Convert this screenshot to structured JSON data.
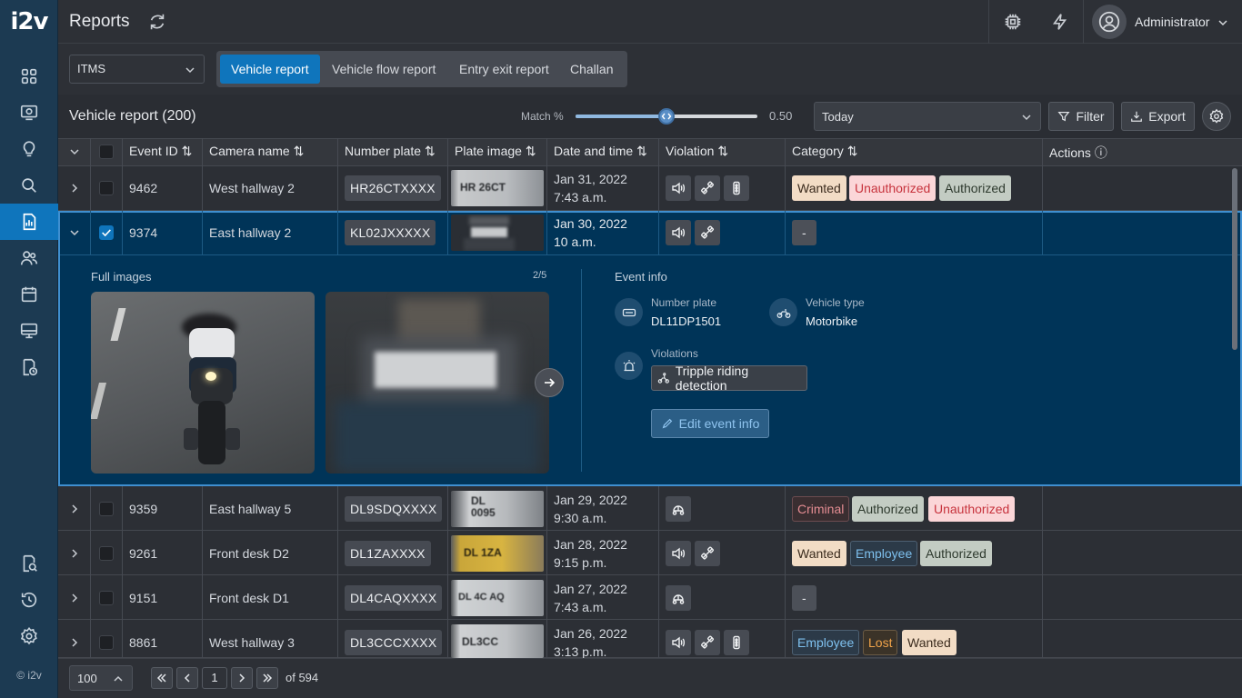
{
  "app": {
    "logo": "i2v",
    "copyright": "© i2v"
  },
  "header": {
    "title": "Reports",
    "user": "Administrator"
  },
  "toolbar": {
    "select": "ITMS",
    "tabs": [
      {
        "label": "Vehicle report",
        "active": true
      },
      {
        "label": "Vehicle flow report"
      },
      {
        "label": "Entry exit report"
      },
      {
        "label": "Challan"
      }
    ]
  },
  "subbar": {
    "title": "Vehicle report (200)",
    "match_label": "Match %",
    "match_value": "0.50",
    "match_fraction": 0.5,
    "date_select": "Today",
    "filter_label": "Filter",
    "export_label": "Export"
  },
  "table": {
    "columns": [
      "Event ID",
      "Camera name",
      "Number plate",
      "Plate image",
      "Date and time",
      "Violation",
      "Category",
      "Actions"
    ],
    "rows": [
      {
        "id": "9462",
        "camera": "West hallway 2",
        "plate": "HR26CTXXXX",
        "plate_img": "HR 26CT",
        "date": "Jan 31, 2022",
        "time": "7:43 a.m.",
        "violations": [
          "horn-icon",
          "seatbelt-icon",
          "signal-icon"
        ],
        "tags": [
          {
            "label": "Wanted",
            "type": "wanted"
          },
          {
            "label": "Unauthorized",
            "type": "unauth"
          },
          {
            "label": "Authorized",
            "type": "auth"
          }
        ]
      },
      {
        "id": "9374",
        "camera": "East hallway 2",
        "plate": "KL02JXXXXX",
        "plate_img": "",
        "date": "Jan 30, 2022",
        "time": "10 a.m.",
        "violations": [
          "horn-icon",
          "seatbelt-icon"
        ],
        "tags": [
          {
            "label": "-",
            "type": "dash"
          }
        ]
      },
      {
        "id": "9359",
        "camera": "East hallway 5",
        "plate": "DL9SDQXXXX",
        "plate_img": "DL 0095",
        "date": "Jan 29, 2022",
        "time": "9:30 a.m.",
        "violations": [
          "helmet-icon"
        ],
        "tags": [
          {
            "label": "Criminal",
            "type": "criminal"
          },
          {
            "label": "Authorized",
            "type": "auth"
          },
          {
            "label": "Unauthorized",
            "type": "unauth"
          }
        ]
      },
      {
        "id": "9261",
        "camera": "Front desk D2",
        "plate": "DL1ZAXXXX",
        "plate_img": "DL 1ZA",
        "date": "Jan 28, 2022",
        "time": "9:15 p.m.",
        "violations": [
          "horn-icon",
          "seatbelt-icon"
        ],
        "tags": [
          {
            "label": "Wanted",
            "type": "wanted"
          },
          {
            "label": "Employee",
            "type": "employee"
          },
          {
            "label": "Authorized",
            "type": "auth"
          }
        ]
      },
      {
        "id": "9151",
        "camera": "Front desk D1",
        "plate": "DL4CAQXXXX",
        "plate_img": "DL 4C AQ",
        "date": "Jan 27, 2022",
        "time": "7:43 a.m.",
        "violations": [
          "helmet-icon"
        ],
        "tags": [
          {
            "label": "-",
            "type": "dash"
          }
        ]
      },
      {
        "id": "8861",
        "camera": "West hallway 3",
        "plate": "DL3CCCXXXX",
        "plate_img": "DL3CC",
        "date": "Jan 26, 2022",
        "time": "3:13 p.m.",
        "violations": [
          "horn-icon",
          "seatbelt-icon",
          "signal-icon"
        ],
        "tags": [
          {
            "label": "Employee",
            "type": "employee"
          },
          {
            "label": "Lost",
            "type": "lost"
          },
          {
            "label": "Wanted",
            "type": "wanted"
          }
        ]
      }
    ]
  },
  "expanded": {
    "full_images_label": "Full images",
    "counter": "2/5",
    "event_info_label": "Event info",
    "number_plate_label": "Number plate",
    "number_plate_value": "DL11DP1501",
    "vehicle_type_label": "Vehicle type",
    "vehicle_type_value": "Motorbike",
    "violations_label": "Violations",
    "violation_chip": "Tripple riding detection",
    "edit_label": "Edit event info"
  },
  "pagination": {
    "per_page": "100",
    "page": "1",
    "of_label": "of 594"
  },
  "colors": {
    "accent": "#0f75bc",
    "sidebar": "#1c3a52",
    "expanded": "#003458"
  }
}
